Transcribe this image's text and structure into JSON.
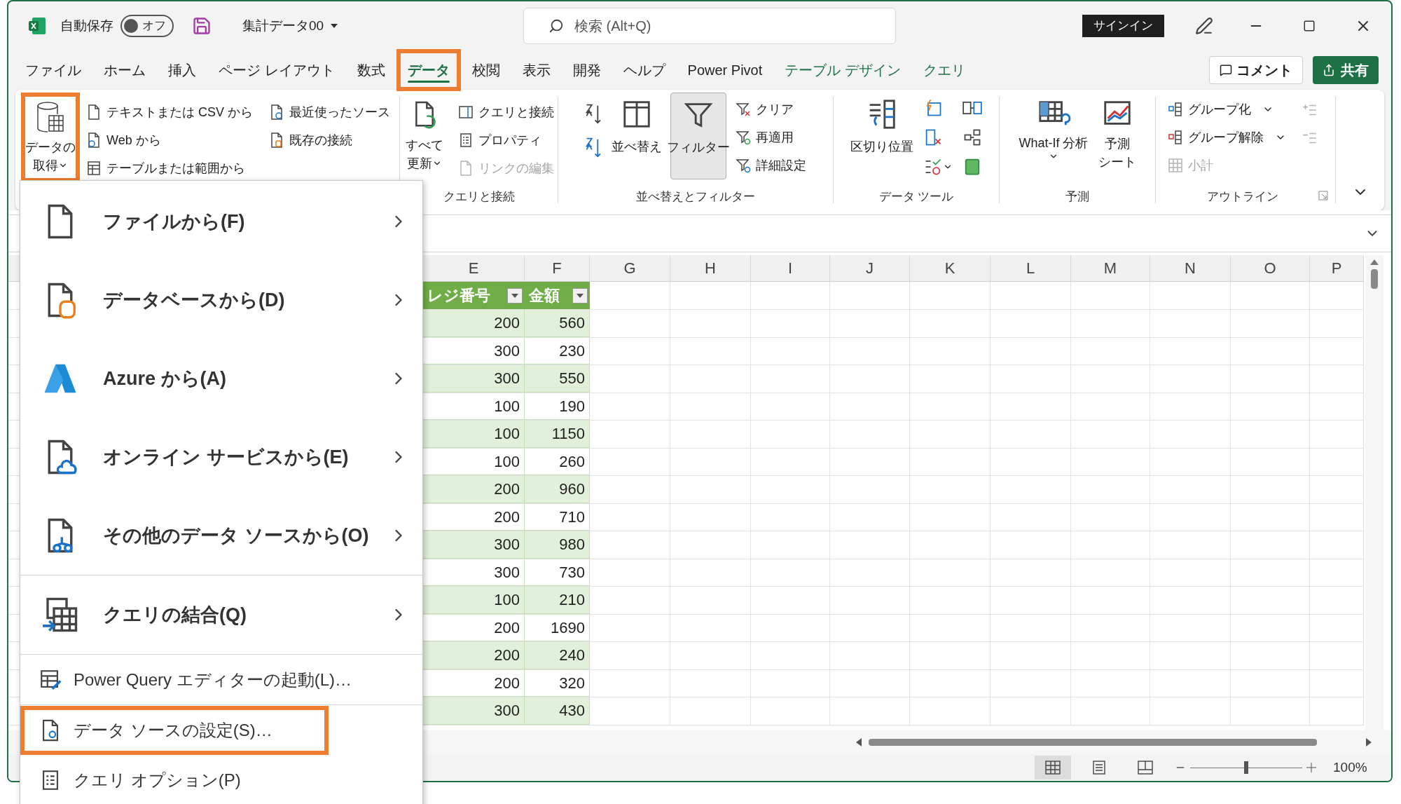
{
  "title_bar": {
    "autosave": {
      "label": "自動保存",
      "on": false,
      "state_label": "オフ"
    },
    "file_name": "集計データ00",
    "search": {
      "placeholder": "検索 (Alt+Q)"
    },
    "sign_in": "サインイン"
  },
  "tabs": [
    {
      "label": "ファイル",
      "selected": false,
      "highlighted": false,
      "kind": "standard"
    },
    {
      "label": "ホーム",
      "selected": false,
      "highlighted": false,
      "kind": "standard"
    },
    {
      "label": "挿入",
      "selected": false,
      "highlighted": false,
      "kind": "standard"
    },
    {
      "label": "ページ レイアウト",
      "selected": false,
      "highlighted": false,
      "kind": "standard"
    },
    {
      "label": "数式",
      "selected": false,
      "highlighted": false,
      "kind": "standard"
    },
    {
      "label": "データ",
      "selected": true,
      "highlighted": true,
      "kind": "standard"
    },
    {
      "label": "校閲",
      "selected": false,
      "highlighted": false,
      "kind": "standard"
    },
    {
      "label": "表示",
      "selected": false,
      "highlighted": false,
      "kind": "standard"
    },
    {
      "label": "開発",
      "selected": false,
      "highlighted": false,
      "kind": "standard"
    },
    {
      "label": "ヘルプ",
      "selected": false,
      "highlighted": false,
      "kind": "standard"
    },
    {
      "label": "Power Pivot",
      "selected": false,
      "highlighted": false,
      "kind": "standard"
    },
    {
      "label": "テーブル デザイン",
      "selected": false,
      "highlighted": false,
      "kind": "contextual"
    },
    {
      "label": "クエリ",
      "selected": false,
      "highlighted": false,
      "kind": "contextual"
    }
  ],
  "comment_button": "コメント",
  "share_button": "共有",
  "ribbon": {
    "get_transform": {
      "get_data": {
        "label_lines": [
          "データの",
          "取得"
        ],
        "highlighted": true
      },
      "commands": [
        "テキストまたは CSV から",
        "Web から",
        "テーブルまたは範囲から",
        "最近使ったソース",
        "既存の接続"
      ]
    },
    "queries": {
      "label": "クエリと接続",
      "refresh_all": {
        "label_lines": [
          "すべて",
          "更新"
        ]
      },
      "commands": [
        {
          "label": "クエリと接続",
          "disabled": false
        },
        {
          "label": "プロパティ",
          "disabled": false
        },
        {
          "label": "リンクの編集",
          "disabled": true
        }
      ]
    },
    "sort_filter": {
      "label": "並べ替えとフィルター",
      "sort": "並べ替え",
      "filter": {
        "label": "フィルター",
        "pressed": true
      },
      "commands": [
        "クリア",
        "再適用",
        "詳細設定"
      ]
    },
    "data_tools": {
      "label": "データ ツール",
      "text_to_columns": "区切り位置"
    },
    "forecast": {
      "label": "予測",
      "what_if": "What-If 分析",
      "forecast_sheet": {
        "label_lines": [
          "予測",
          "シート"
        ]
      }
    },
    "outline": {
      "label": "アウトライン",
      "commands": [
        {
          "label": "グループ化",
          "disabled": false
        },
        {
          "label": "グループ解除",
          "disabled": false
        },
        {
          "label": "小計",
          "disabled": true
        }
      ]
    }
  },
  "get_data_menu": {
    "items": [
      {
        "label": "ファイルから(F)",
        "kind": "large",
        "highlighted": false
      },
      {
        "label": "データベースから(D)",
        "kind": "large",
        "highlighted": false
      },
      {
        "label": "Azure から(A)",
        "kind": "large",
        "highlighted": false
      },
      {
        "label": "オンライン サービスから(E)",
        "kind": "large",
        "highlighted": false
      },
      {
        "label": "その他のデータ ソースから(O)",
        "kind": "large",
        "highlighted": false
      },
      {
        "label": "クエリの結合(Q)",
        "kind": "large",
        "highlighted": false
      },
      {
        "label": "Power Query エディターの起動(L)…",
        "kind": "small",
        "highlighted": false
      },
      {
        "label": "データ ソースの設定(S)…",
        "kind": "small",
        "highlighted": true
      },
      {
        "label": "クエリ オプション(P)",
        "kind": "small",
        "highlighted": false
      }
    ]
  },
  "sheet": {
    "columns": [
      "E",
      "F",
      "G",
      "H",
      "I",
      "J",
      "K",
      "L",
      "M",
      "N",
      "O",
      "P"
    ],
    "table": {
      "headers": [
        "レジ番号",
        "金額"
      ],
      "rows": [
        [
          "200",
          "560"
        ],
        [
          "300",
          "230"
        ],
        [
          "300",
          "550"
        ],
        [
          "100",
          "190"
        ],
        [
          "100",
          "1150"
        ],
        [
          "100",
          "260"
        ],
        [
          "200",
          "960"
        ],
        [
          "200",
          "710"
        ],
        [
          "300",
          "980"
        ],
        [
          "300",
          "730"
        ],
        [
          "100",
          "210"
        ],
        [
          "200",
          "1690"
        ],
        [
          "200",
          "240"
        ],
        [
          "200",
          "320"
        ],
        [
          "300",
          "430"
        ]
      ]
    }
  },
  "status_bar": {
    "views": [
      {
        "selected": true
      },
      {
        "selected": false
      },
      {
        "selected": false
      }
    ],
    "zoom": {
      "level": 0.5,
      "reading": "100%"
    }
  }
}
